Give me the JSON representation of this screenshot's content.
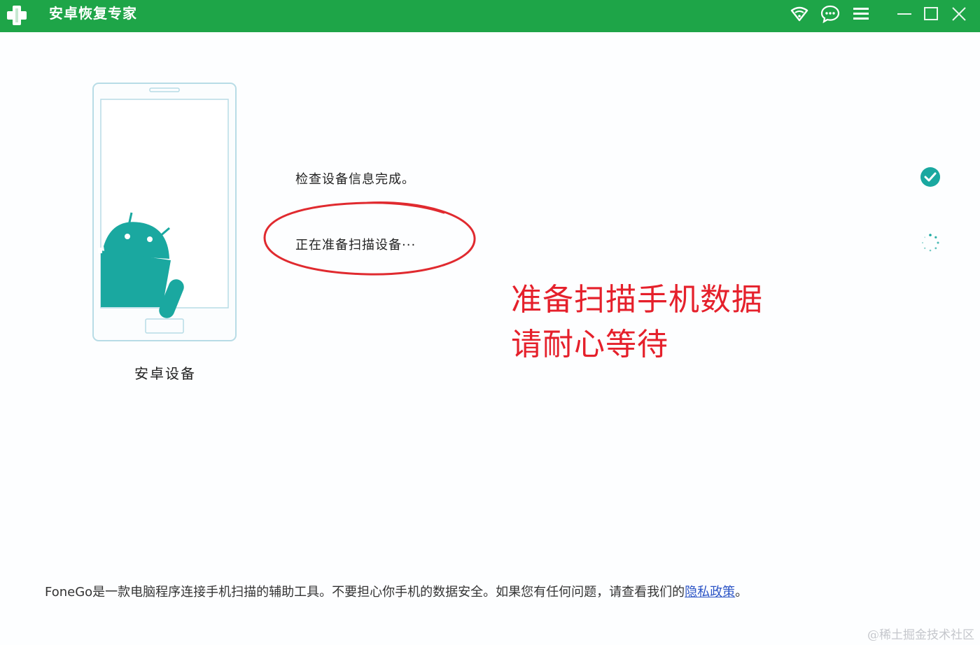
{
  "app": {
    "title": "安卓恢复专家",
    "logo_icon": "plus-cross-icon",
    "accent_color": "#1ea548"
  },
  "titlebar": {
    "buttons": [
      {
        "name": "wifi-icon"
      },
      {
        "name": "chat-icon"
      },
      {
        "name": "menu-icon"
      },
      {
        "name": "minimize-icon"
      },
      {
        "name": "maximize-icon"
      },
      {
        "name": "close-icon"
      }
    ]
  },
  "device": {
    "label": "安卓设备",
    "illustration_icon": "android-phone-icon"
  },
  "steps": [
    {
      "text": "检查设备信息完成。",
      "status": "done",
      "icon": "check-circle-icon"
    },
    {
      "text": "正在准备扫描设备···",
      "status": "loading",
      "icon": "spinner-icon"
    }
  ],
  "annotation": {
    "line1": "准备扫描手机数据",
    "line2": "请耐心等待",
    "color": "#e5202b"
  },
  "footer": {
    "text": "FoneGo是一款电脑程序连接手机扫描的辅助工具。不要担心你手机的数据安全。如果您有任何问题，请查看我们的",
    "link_text": "隐私政策",
    "suffix": "。"
  },
  "watermark": "@稀土掘金技术社区"
}
